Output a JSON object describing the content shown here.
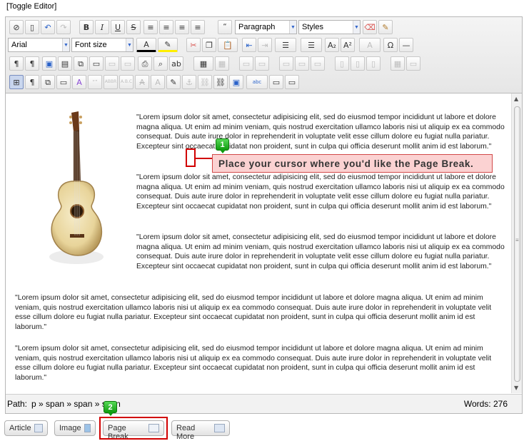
{
  "toggle_editor_label": "[Toggle Editor]",
  "toolbar": {
    "row1": {
      "bold": "B",
      "italic": "I",
      "underline": "U",
      "strike": "S",
      "blockquote": "“",
      "format_select": "Paragraph",
      "styles_select": "Styles"
    },
    "row2": {
      "font_family": "Arial",
      "font_size": "Font size",
      "subscript": "A₂",
      "superscript": "A²",
      "omega": "Ω"
    },
    "row4": {
      "spellcheck": "abc"
    }
  },
  "content": {
    "paragraphs_right": [
      "\"Lorem ipsum dolor sit amet, consectetur adipisicing elit, sed do eiusmod tempor incididunt ut labore et dolore magna aliqua. Ut enim ad minim veniam, quis nostrud exercitation ullamco laboris nisi ut aliquip ex ea commodo consequat. Duis aute irure dolor in reprehenderit in voluptate velit esse cillum dolore eu fugiat nulla pariatur. Excepteur sint occaecat cupidatat non proident, sunt in culpa qui officia deserunt mollit anim id est laborum.\"",
      "\"Lorem ipsum dolor sit amet, consectetur adipisicing elit, sed do eiusmod tempor incididunt ut labore et dolore magna aliqua. Ut enim ad minim veniam, quis nostrud exercitation ullamco laboris nisi ut aliquip ex ea commodo consequat. Duis aute irure dolor in reprehenderit in voluptate velit esse cillum dolore eu fugiat nulla pariatur. Excepteur sint occaecat cupidatat non proident, sunt in culpa qui officia deserunt mollit anim id est laborum.\"",
      "\"Lorem ipsum dolor sit amet, consectetur adipisicing elit, sed do eiusmod tempor incididunt ut labore et dolore magna aliqua. Ut enim ad minim veniam, quis nostrud exercitation ullamco laboris nisi ut aliquip ex ea commodo consequat. Duis aute irure dolor in reprehenderit in voluptate velit esse cillum dolore eu fugiat nulla pariatur. Excepteur sint occaecat cupidatat non proident, sunt in culpa qui officia deserunt mollit anim id est laborum.\""
    ],
    "paragraphs_full": [
      "\"Lorem ipsum dolor sit amet, consectetur adipisicing elit, sed do eiusmod tempor incididunt ut labore et dolore magna aliqua. Ut enim ad minim veniam, quis nostrud exercitation ullamco laboris nisi ut aliquip ex ea commodo consequat. Duis aute irure dolor in reprehenderit in voluptate velit esse cillum dolore eu fugiat nulla pariatur. Excepteur sint occaecat cupidatat non proident, sunt in culpa qui officia deserunt mollit anim id est laborum.\"",
      "\"Lorem ipsum dolor sit amet, consectetur adipisicing elit, sed do eiusmod tempor incididunt ut labore et dolore magna aliqua. Ut enim ad minim veniam, quis nostrud exercitation ullamco laboris nisi ut aliquip ex ea commodo consequat. Duis aute irure dolor in reprehenderit in voluptate velit esse cillum dolore eu fugiat nulla pariatur. Excepteur sint occaecat cupidatat non proident, sunt in culpa qui officia deserunt mollit anim id est laborum.\""
    ]
  },
  "statusbar": {
    "path_label": "Path:",
    "path_value": "p » span » span » span",
    "words": "Words: 276"
  },
  "buttons": {
    "article": "Article",
    "image": "Image",
    "page_break": "Page Break",
    "read_more": "Read More"
  },
  "annotations": {
    "step1_number": "1",
    "step1_text": "Place your cursor where you'd like the Page Break.",
    "step2_number": "2"
  },
  "colors": {
    "highlight": "#d10000",
    "callout_bg": "#fbd2d2",
    "badge_green": "#1aaa1a"
  }
}
